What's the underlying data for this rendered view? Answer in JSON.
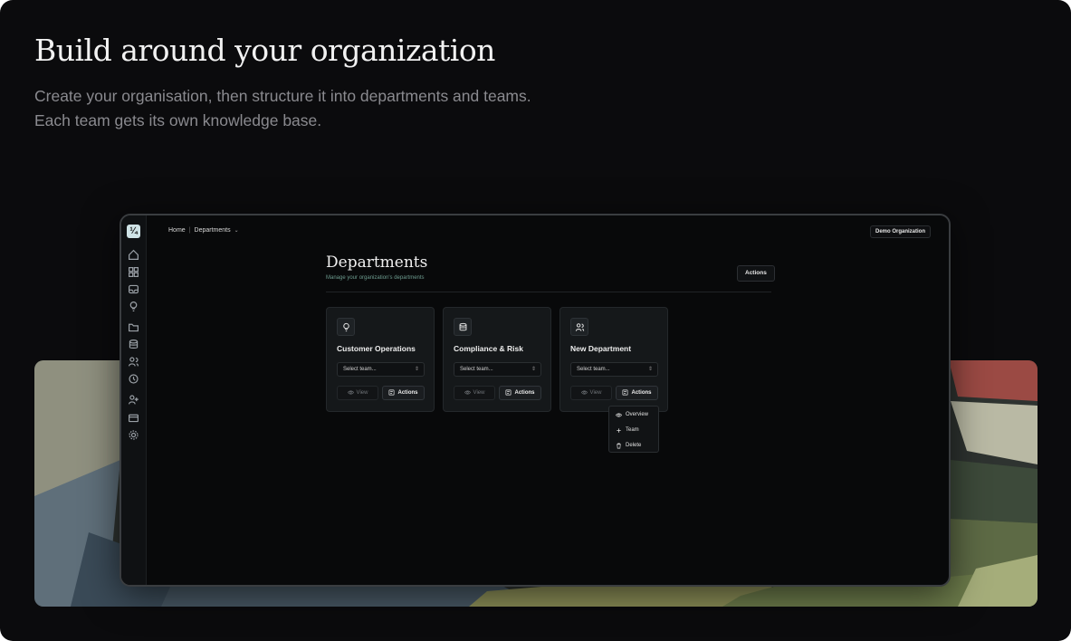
{
  "hero": {
    "title": "Build around your organization",
    "subtitle": "Create your organisation, then structure it into departments and teams. Each team gets its own knowledge base."
  },
  "app": {
    "breadcrumb": {
      "home": "Home",
      "separator": "|",
      "current": "Departments"
    },
    "org_button": "Demo Organization",
    "page_title": "Departments",
    "page_subtitle": "Manage your organization's departments",
    "top_actions_label": "Actions",
    "sidebar_icons": [
      "home-icon",
      "grid-icon",
      "inbox-icon",
      "bulb-icon",
      "folder-icon",
      "database-icon",
      "users-icon",
      "history-icon",
      "user-plus-icon",
      "card-icon",
      "settings-icon"
    ],
    "cards": [
      {
        "title": "Customer Operations",
        "icon": "lightbulb-icon",
        "select_placeholder": "Select team...",
        "view_label": "View",
        "actions_label": "Actions"
      },
      {
        "title": "Compliance & Risk",
        "icon": "database-icon",
        "select_placeholder": "Select team...",
        "view_label": "View",
        "actions_label": "Actions"
      },
      {
        "title": "New Department",
        "icon": "users-icon",
        "select_placeholder": "Select team...",
        "view_label": "View",
        "actions_label": "Actions"
      }
    ],
    "dropdown_menu": [
      {
        "label": "Overview",
        "icon": "eye-icon"
      },
      {
        "label": "Team",
        "icon": "plus-icon"
      },
      {
        "label": "Delete",
        "icon": "trash-icon"
      }
    ]
  },
  "colors": {
    "background": "#0b0b0d",
    "accent_text": "#6d9c8f",
    "logo": "#cfe3e6"
  }
}
